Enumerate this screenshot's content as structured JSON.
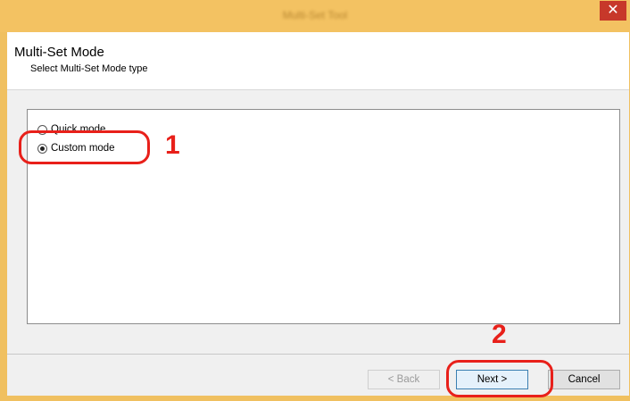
{
  "window": {
    "title": "Multi-Set Tool",
    "close_label": "✕"
  },
  "header": {
    "title": "Multi-Set Mode",
    "subtitle": "Select Multi-Set Mode type"
  },
  "options": [
    {
      "label": "Quick mode",
      "selected": false
    },
    {
      "label": "Custom mode",
      "selected": true
    }
  ],
  "callouts": {
    "step1": "1",
    "step2": "2",
    "color": "#e8201a"
  },
  "buttons": {
    "back": "< Back",
    "next": "Next >",
    "cancel": "Cancel"
  }
}
